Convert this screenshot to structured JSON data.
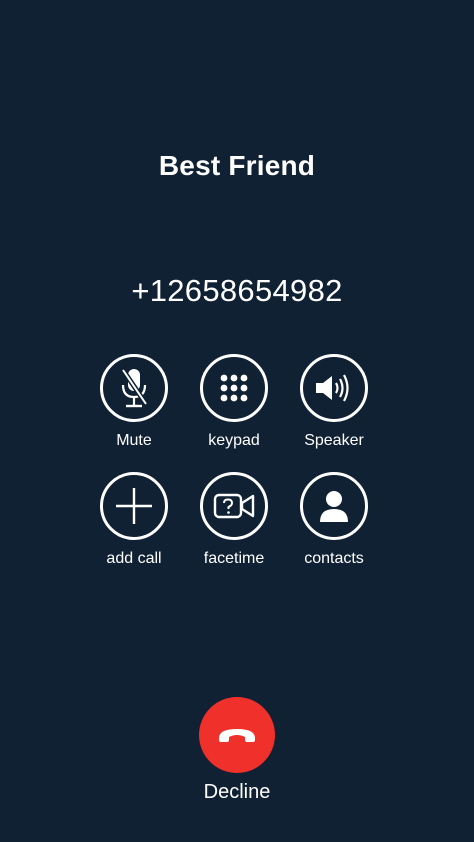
{
  "caller": {
    "name": "Best Friend",
    "number": "+12658654982"
  },
  "controls": [
    {
      "label": "Mute",
      "icon": "microphone-muted-icon"
    },
    {
      "label": "keypad",
      "icon": "keypad-icon"
    },
    {
      "label": "Speaker",
      "icon": "speaker-icon"
    },
    {
      "label": "add call",
      "icon": "plus-icon"
    },
    {
      "label": "facetime",
      "icon": "video-camera-icon"
    },
    {
      "label": "contacts",
      "icon": "contact-icon"
    }
  ],
  "decline": {
    "label": "Decline",
    "icon": "hang-up-phone-icon"
  },
  "colors": {
    "background": "#0f2133",
    "decline": "#f0302a",
    "foreground": "#ffffff"
  }
}
